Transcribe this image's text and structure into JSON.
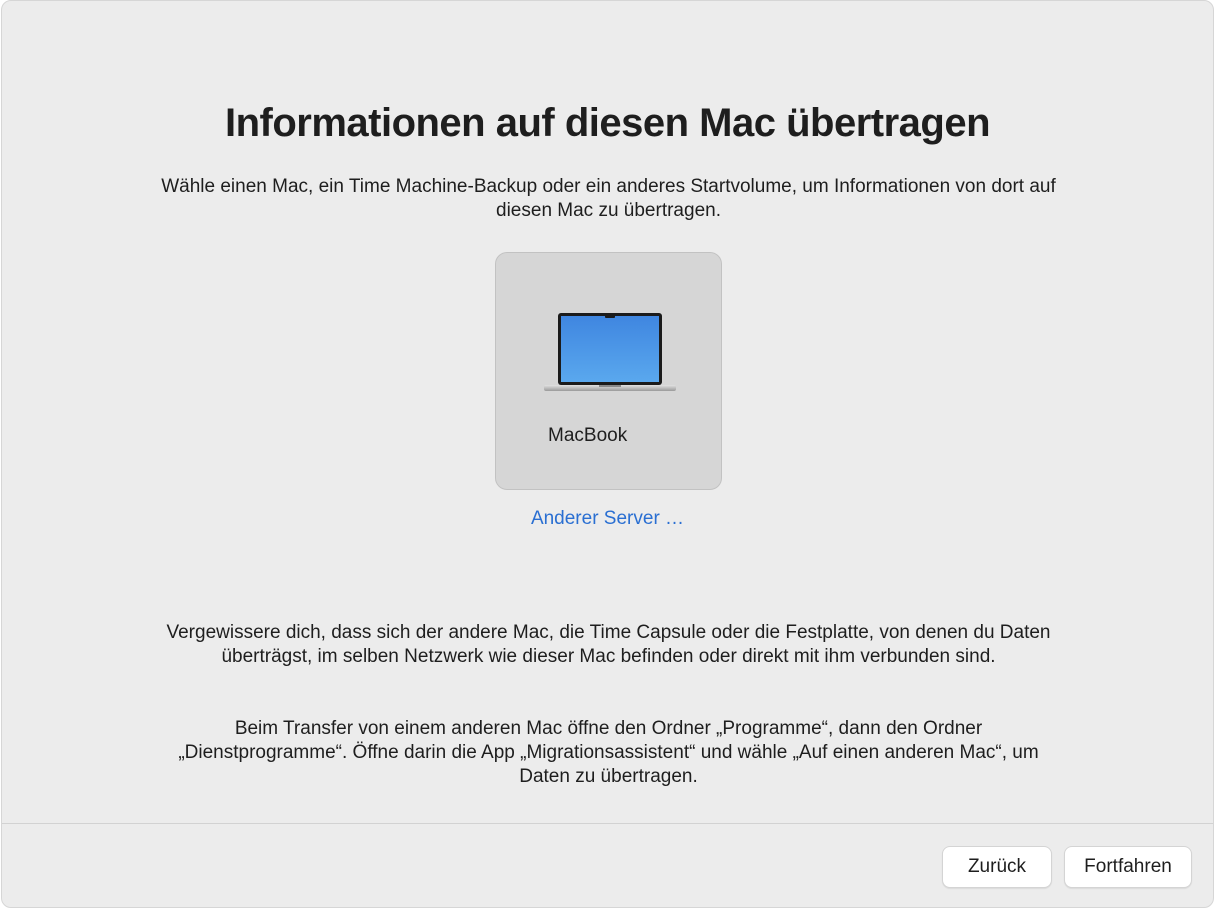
{
  "dialog": {
    "title": "Informationen auf diesen Mac übertragen",
    "subtitle": "Wähle einen Mac, ein Time Machine-Backup oder ein anderes Startvolume, um Informationen von dort auf diesen Mac zu übertragen."
  },
  "devices": [
    {
      "label": "MacBook",
      "icon": "macbook-icon"
    }
  ],
  "links": {
    "other_server": "Anderer Server …"
  },
  "notes": {
    "network": "Vergewissere dich, dass sich der andere Mac, die Time Capsule oder die Festplatte, von denen du Daten überträgst, im selben Netzwerk wie dieser Mac befinden oder direkt mit ihm verbunden sind.",
    "transfer": "Beim Transfer von einem anderen Mac öffne den Ordner „Programme“, dann den Ordner „Dienstprogramme“. Öffne darin die App „Migrationsassistent“ und wähle „Auf einen anderen Mac“, um Daten zu übertragen."
  },
  "buttons": {
    "back": "Zurück",
    "continue": "Fortfahren"
  },
  "colors": {
    "background": "#ececec",
    "tile": "#d6d6d6",
    "link": "#2a6fd2",
    "screen": "#4a90e2"
  }
}
